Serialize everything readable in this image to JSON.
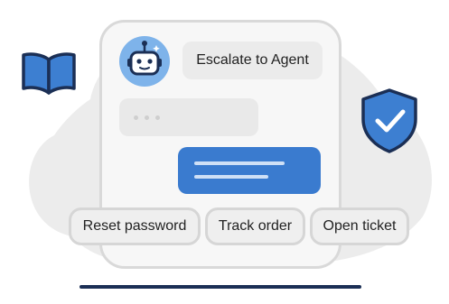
{
  "chat": {
    "escalate_label": "Escalate to Agent"
  },
  "quick_replies": [
    {
      "label": "Reset password"
    },
    {
      "label": "Track order"
    },
    {
      "label": "Open ticket"
    }
  ],
  "icons": {
    "book": "book-icon",
    "shield": "shield-check-icon",
    "bot": "robot-icon"
  },
  "colors": {
    "accent_blue": "#3a7bcf",
    "avatar_blue": "#7eb3ea",
    "icon_navy": "#1b2f55",
    "background_blob": "#ececec"
  }
}
